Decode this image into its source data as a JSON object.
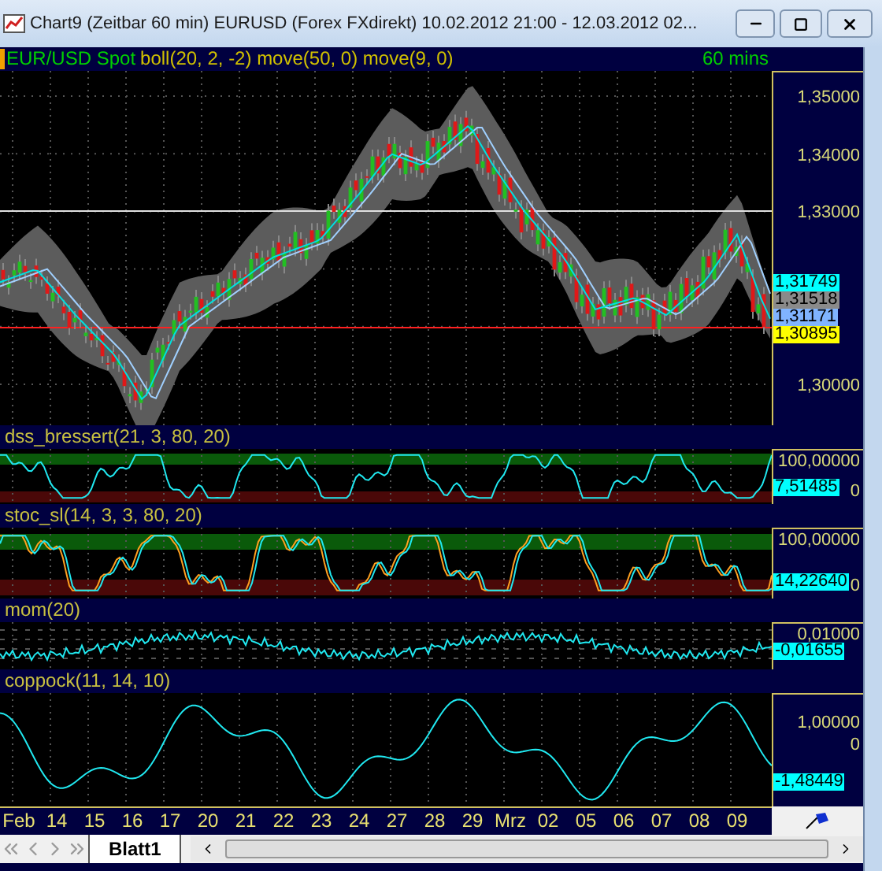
{
  "window": {
    "title": "Chart9 (Zeitbar 60 min)  EURUSD (Forex FXdirekt) 10.02.2012 21:00 - 12.03.2012 02..."
  },
  "panels": [
    {
      "kind": "price",
      "symbol": "EUR/USD Spot",
      "studies": "boll(20, 2, -2) move(50, 0) move(9, 0)",
      "interval": "60 mins",
      "axis_labels": [
        "1,35000",
        "1,34000",
        "1,33000",
        "1,30000"
      ],
      "tags": [
        {
          "text": "1,31749",
          "color": "#00ffff"
        },
        {
          "text": "1,31518",
          "color": "#8a8a8a"
        },
        {
          "text": "1,31171",
          "color": "#80b4ff"
        },
        {
          "text": "1,30895",
          "color": "#ffff00"
        }
      ]
    },
    {
      "kind": "oscillator",
      "title": "dss_bressert(21, 3, 80, 20)",
      "axis_labels": [
        "100,00000",
        "0"
      ],
      "tags": [
        {
          "text": "7,51485",
          "color": "#00ffff"
        }
      ]
    },
    {
      "kind": "stochastic",
      "title": "stoc_sl(14, 3, 3, 80, 20)",
      "axis_labels": [
        "100,00000",
        "0"
      ],
      "tags": [
        {
          "text": "14,22640",
          "color": "#00ffff"
        }
      ]
    },
    {
      "kind": "momentum",
      "title": "mom(20)",
      "axis_labels": [
        "0,01000"
      ],
      "tags": [
        {
          "text": "-0,01655",
          "color": "#00ffff"
        }
      ]
    },
    {
      "kind": "coppock",
      "title": "coppock(11, 14, 10)",
      "axis_labels": [
        "1,00000",
        "0"
      ],
      "tags": [
        {
          "text": "-1,48449",
          "color": "#00ffff"
        }
      ]
    }
  ],
  "x_axis": {
    "labels": [
      "Feb",
      "14",
      "15",
      "16",
      "17",
      "20",
      "21",
      "22",
      "23",
      "24",
      "27",
      "28",
      "29",
      "Mrz",
      "02",
      "05",
      "06",
      "07",
      "08",
      "09"
    ]
  },
  "sheet_tabs": [
    {
      "label": "Blatt1",
      "selected": true
    }
  ]
}
